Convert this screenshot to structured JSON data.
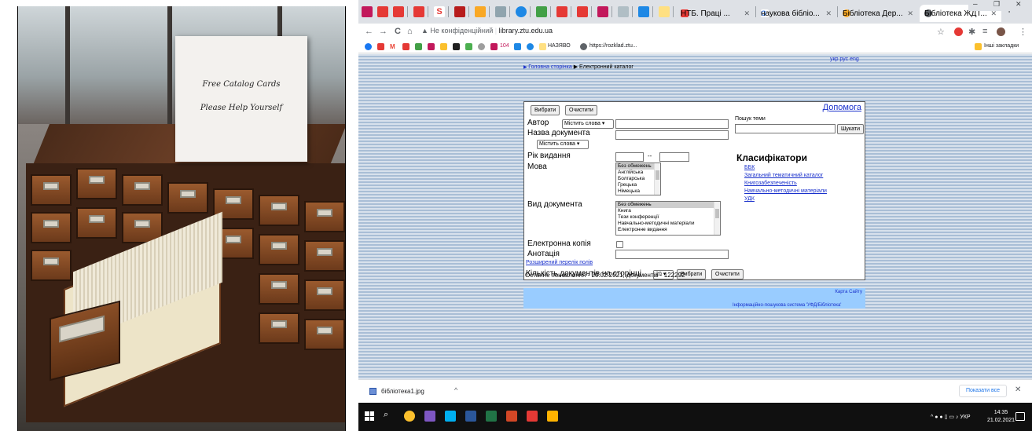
{
  "photo": {
    "sign_line1": "Free Catalog Cards",
    "sign_line2": "Please Help Yourself"
  },
  "browser": {
    "tabs": [
      {
        "label": "НТБ. Праці ..."
      },
      {
        "label": "наукова бібліо..."
      },
      {
        "label": "Бібліотека Дер..."
      },
      {
        "label": "Бібліотека ЖДТ..."
      }
    ],
    "new_tab": "+",
    "window_controls": {
      "minimize": "–",
      "maximize": "❐",
      "close": "✕"
    },
    "nav": {
      "back": "←",
      "forward": "→",
      "reload": "C",
      "home": "⌂"
    },
    "address": {
      "security": "Не конфіденційний",
      "url": "library.ztu.edu.ua"
    },
    "bookmarks": {
      "counter": "104",
      "item_naz": "НАЗЯВО",
      "item_rozklad": "https://rozklad.ztu...",
      "other": "Інші закладки"
    }
  },
  "page": {
    "langs": "укр рус eng",
    "breadcrumb": {
      "home": "Головна сторінка",
      "current": "Електронний каталог"
    },
    "buttons": {
      "select": "Вибрати",
      "clear": "Очистити"
    },
    "help": "Допомога",
    "fields": {
      "author": "Автор",
      "author_mode": "Містить слова",
      "title": "Назва документа",
      "title_mode": "Містить слова",
      "year": "Рік видання",
      "year_sep": "--",
      "language": "Мова",
      "doctype": "Вид документа",
      "ecopy": "Електронна копія",
      "annotation": "Анотація",
      "advanced": "Розширений перелік полів",
      "perpage": "Кількість документів на сторінці",
      "perpage_value": "20"
    },
    "languages": [
      "Без обмежень",
      "Англійська",
      "Болгарська",
      "Грецька",
      "Німецька"
    ],
    "doctypes": [
      "Без обмежень",
      "Книга",
      "Тези конференції",
      "Навчально-методичні матеріали",
      "Електронне видання"
    ],
    "topic_search": {
      "label": "Пошук теми",
      "button": "Шукати"
    },
    "classifiers": {
      "title": "Класифікатори",
      "items": [
        "ББК",
        "Загальний тематичний каталог",
        "Книгозабезпеченість",
        "Навчально-методичні матеріали",
        "УДК"
      ]
    },
    "last_update": "Останнє поновлення - 20.02.2021, документів - 122292",
    "sitemap": "Карта Сайту",
    "system_name": "Інформаційно-пошукова система 'УФД/Бібліотека'"
  },
  "downloads": {
    "file": "бібліотека1.jpg",
    "show_all": "Показати все"
  },
  "taskbar": {
    "lang": "УКР",
    "time": "14:35",
    "date": "21.02.2021"
  }
}
